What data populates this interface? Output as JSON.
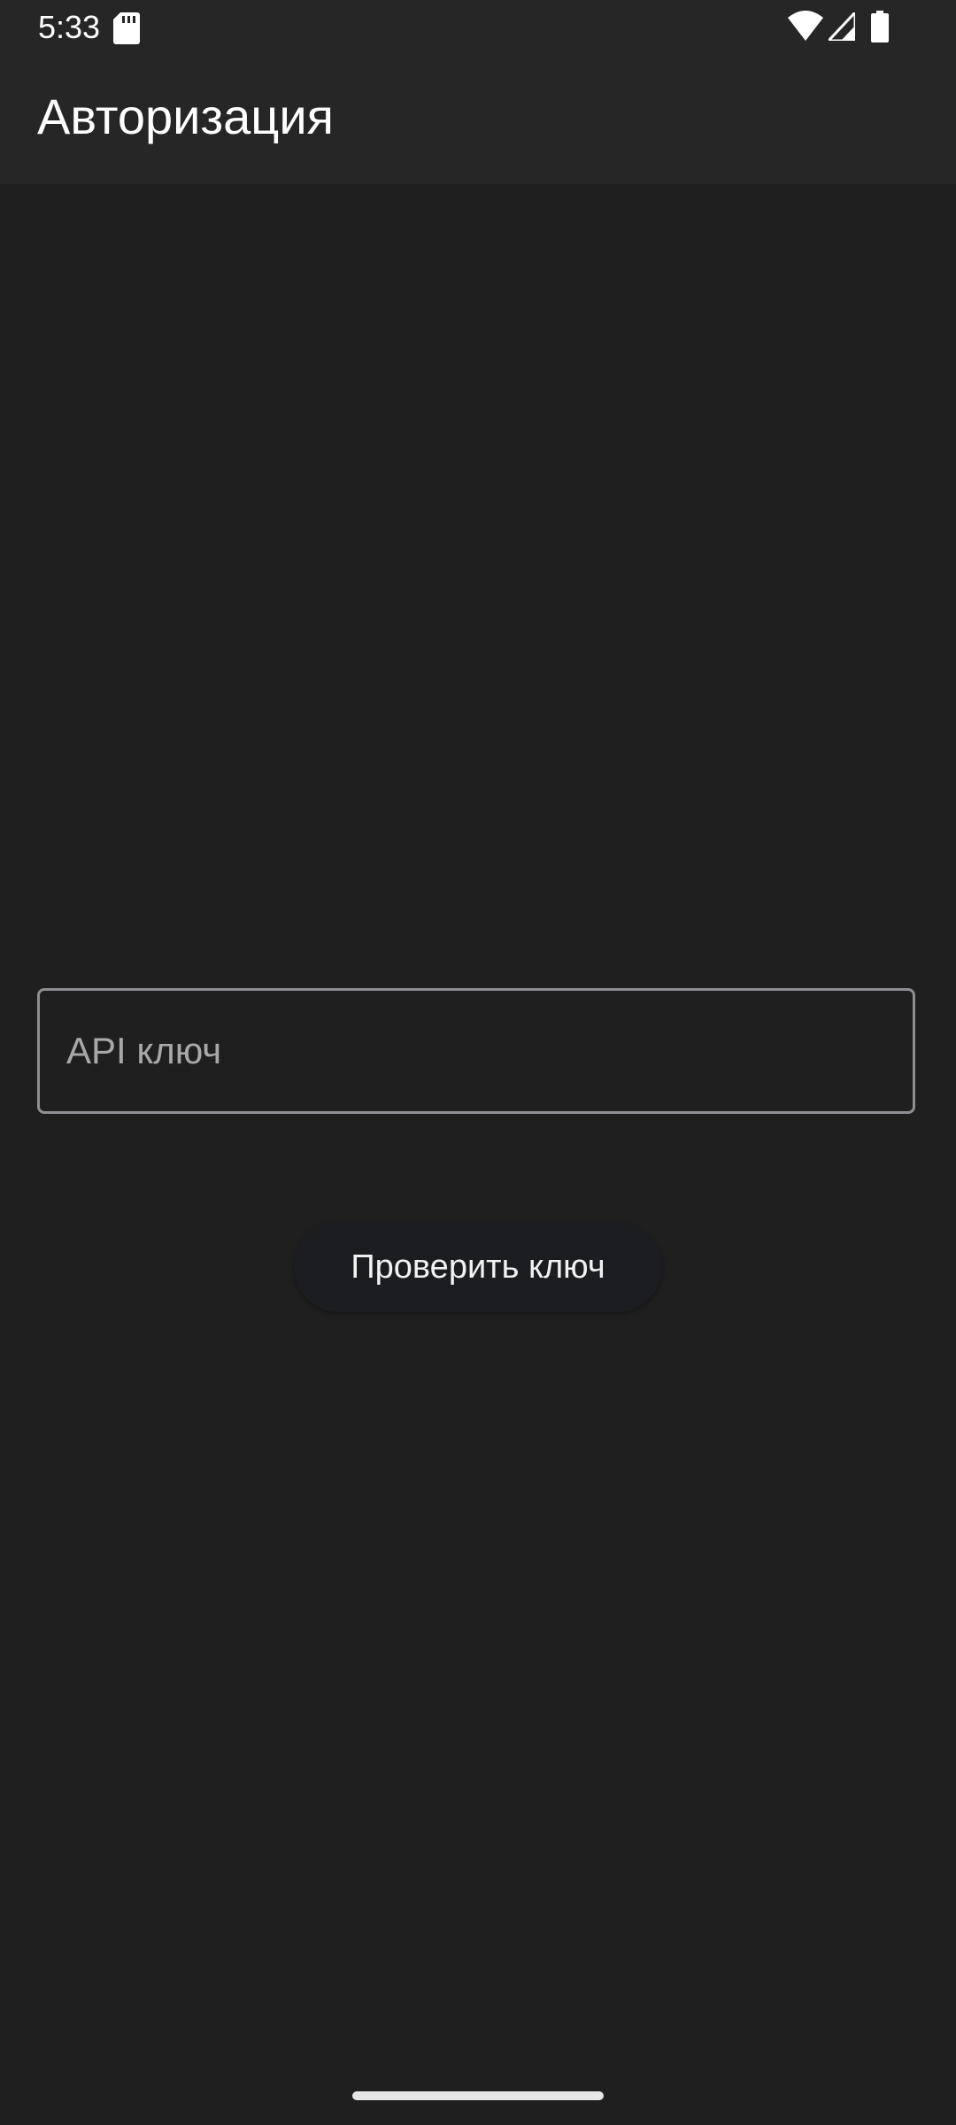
{
  "status_bar": {
    "time": "5:33",
    "icons": [
      "sd-card-icon",
      "wifi-icon",
      "signal-icon",
      "battery-icon"
    ]
  },
  "app_bar": {
    "title": "Авторизация"
  },
  "form": {
    "api_key_placeholder": "API ключ",
    "api_key_value": "",
    "check_button_label": "Проверить ключ"
  },
  "colors": {
    "background": "#1f1f1f",
    "app_bar": "#262626",
    "field_border": "#8e8e93",
    "button_bg": "#1b1d20",
    "text": "#ffffff"
  }
}
